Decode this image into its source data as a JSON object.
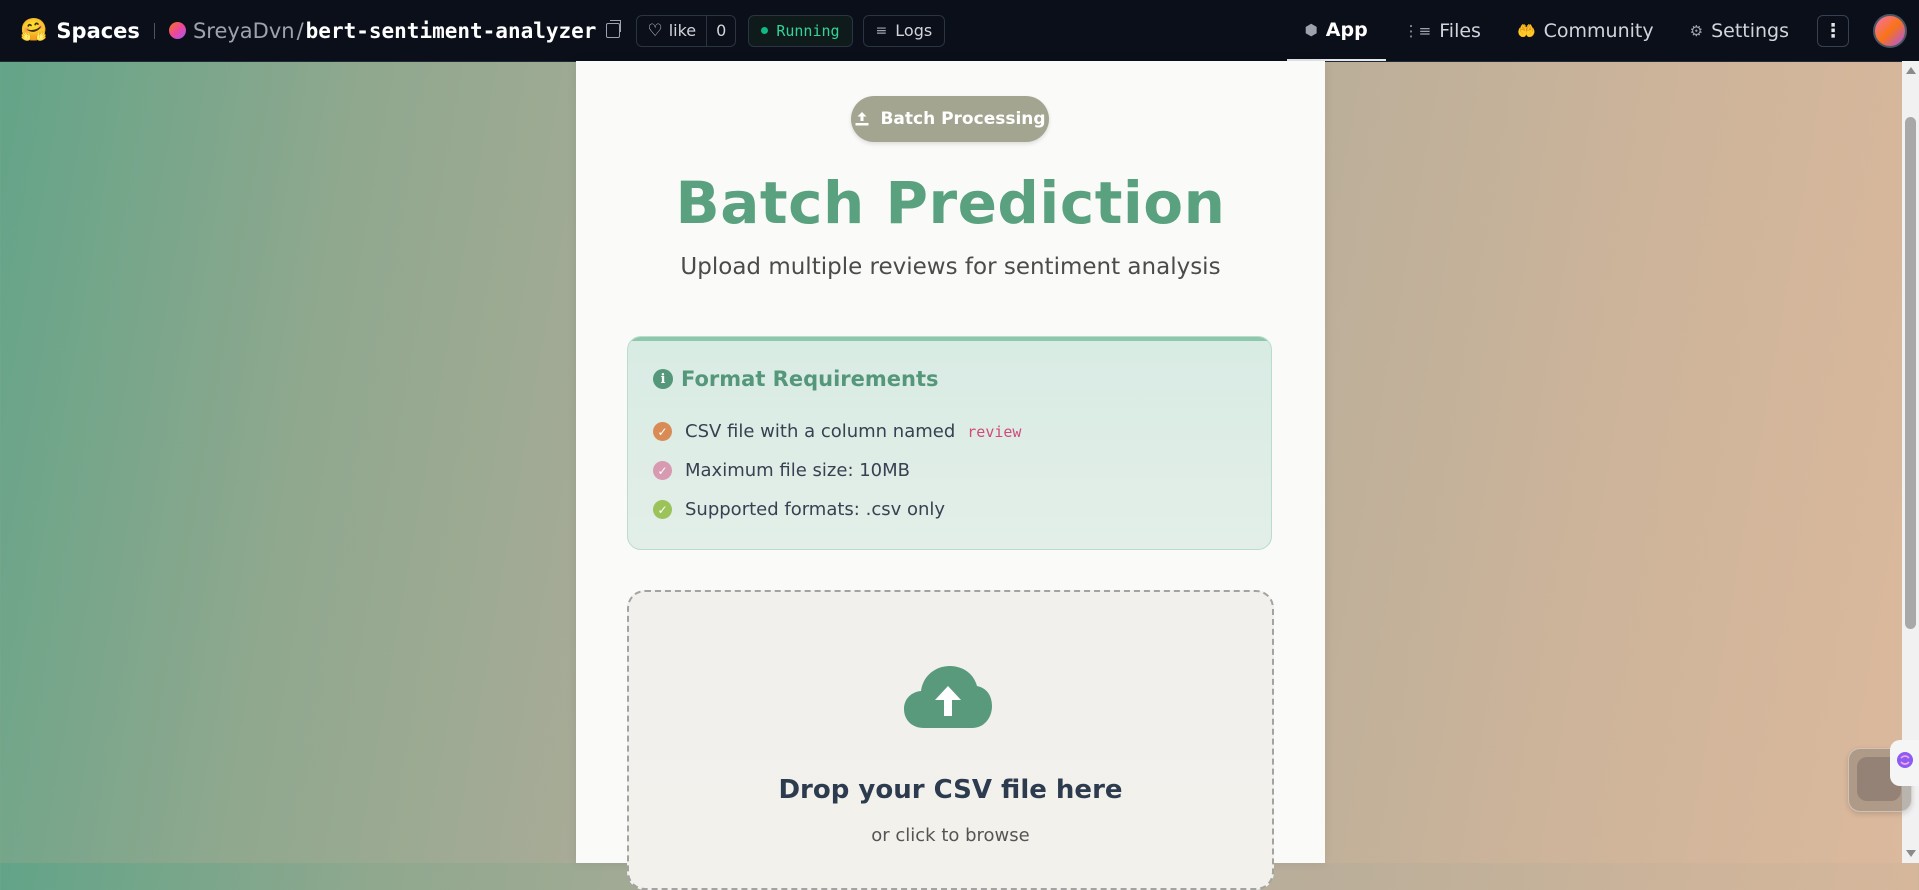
{
  "topbar": {
    "brand_emoji": "🤗",
    "brand_label": "Spaces",
    "owner": "SreyaDvn",
    "separator": "/",
    "repo": "bert-sentiment-analyzer",
    "like_label": "like",
    "like_count": "0",
    "status": "Running",
    "logs_label": "Logs",
    "nav": [
      {
        "label": "App",
        "icon": "cube-icon",
        "glyph": "⬢"
      },
      {
        "label": "Files",
        "icon": "files-icon",
        "glyph": "⋮≡"
      },
      {
        "label": "Community",
        "icon": "community-icon",
        "glyph": "🤲"
      },
      {
        "label": "Settings",
        "icon": "gear-icon",
        "glyph": "⚙"
      }
    ],
    "more_glyph": "⋮"
  },
  "main": {
    "pill_label": "Batch Processing",
    "title": "Batch Prediction",
    "subtitle": "Upload multiple reviews for sentiment analysis",
    "requirements": {
      "title": "Format Requirements",
      "info_glyph": "i",
      "items": [
        {
          "text": "CSV file with a column named",
          "code": "review",
          "color": "#d98b55"
        },
        {
          "text": "Maximum file size: 10MB",
          "code": "",
          "color": "#d79ab0"
        },
        {
          "text": "Supported formats: .csv only",
          "code": "",
          "color": "#9cc35a"
        }
      ]
    },
    "dropzone": {
      "title": "Drop your CSV file here",
      "subtitle": "or click to browse"
    }
  },
  "colors": {
    "accent": "#59a17f",
    "pill": "#a3a591",
    "topbar": "#0b0f19"
  }
}
